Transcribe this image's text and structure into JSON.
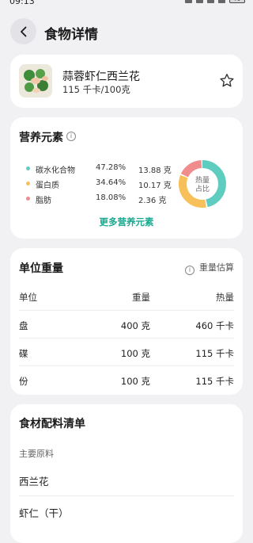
{
  "status_bar": {
    "time": "09:13",
    "battery": "71"
  },
  "header": {
    "title": "食物详情"
  },
  "food": {
    "name": "蒜蓉虾仁西兰花",
    "calories": "115 千卡/100克"
  },
  "nutrition": {
    "title": "营养元素",
    "items": [
      {
        "name": "碳水化合物",
        "percent": "47.28%",
        "grams": "13.88 克",
        "color": "#5ecdc0"
      },
      {
        "name": "蛋白质",
        "percent": "34.64%",
        "grams": "10.17 克",
        "color": "#f7c058"
      },
      {
        "name": "脂肪",
        "percent": "18.08%",
        "grams": "2.36 克",
        "color": "#f08c8c"
      }
    ],
    "donut_label_line1": "热量",
    "donut_label_line2": "占比",
    "more_link": "更多营养元素"
  },
  "unit_weight": {
    "title": "单位重量",
    "estimate": "重量估算",
    "columns": [
      "单位",
      "重量",
      "热量"
    ],
    "rows": [
      {
        "unit": "盘",
        "weight": "400 克",
        "calories": "460 千卡"
      },
      {
        "unit": "碟",
        "weight": "100 克",
        "calories": "115 千卡"
      },
      {
        "unit": "份",
        "weight": "100 克",
        "calories": "115 千卡"
      }
    ]
  },
  "ingredients": {
    "title": "食材配料清单",
    "subtitle": "主要原料",
    "items": [
      "西兰花",
      "虾仁（干）"
    ]
  }
}
